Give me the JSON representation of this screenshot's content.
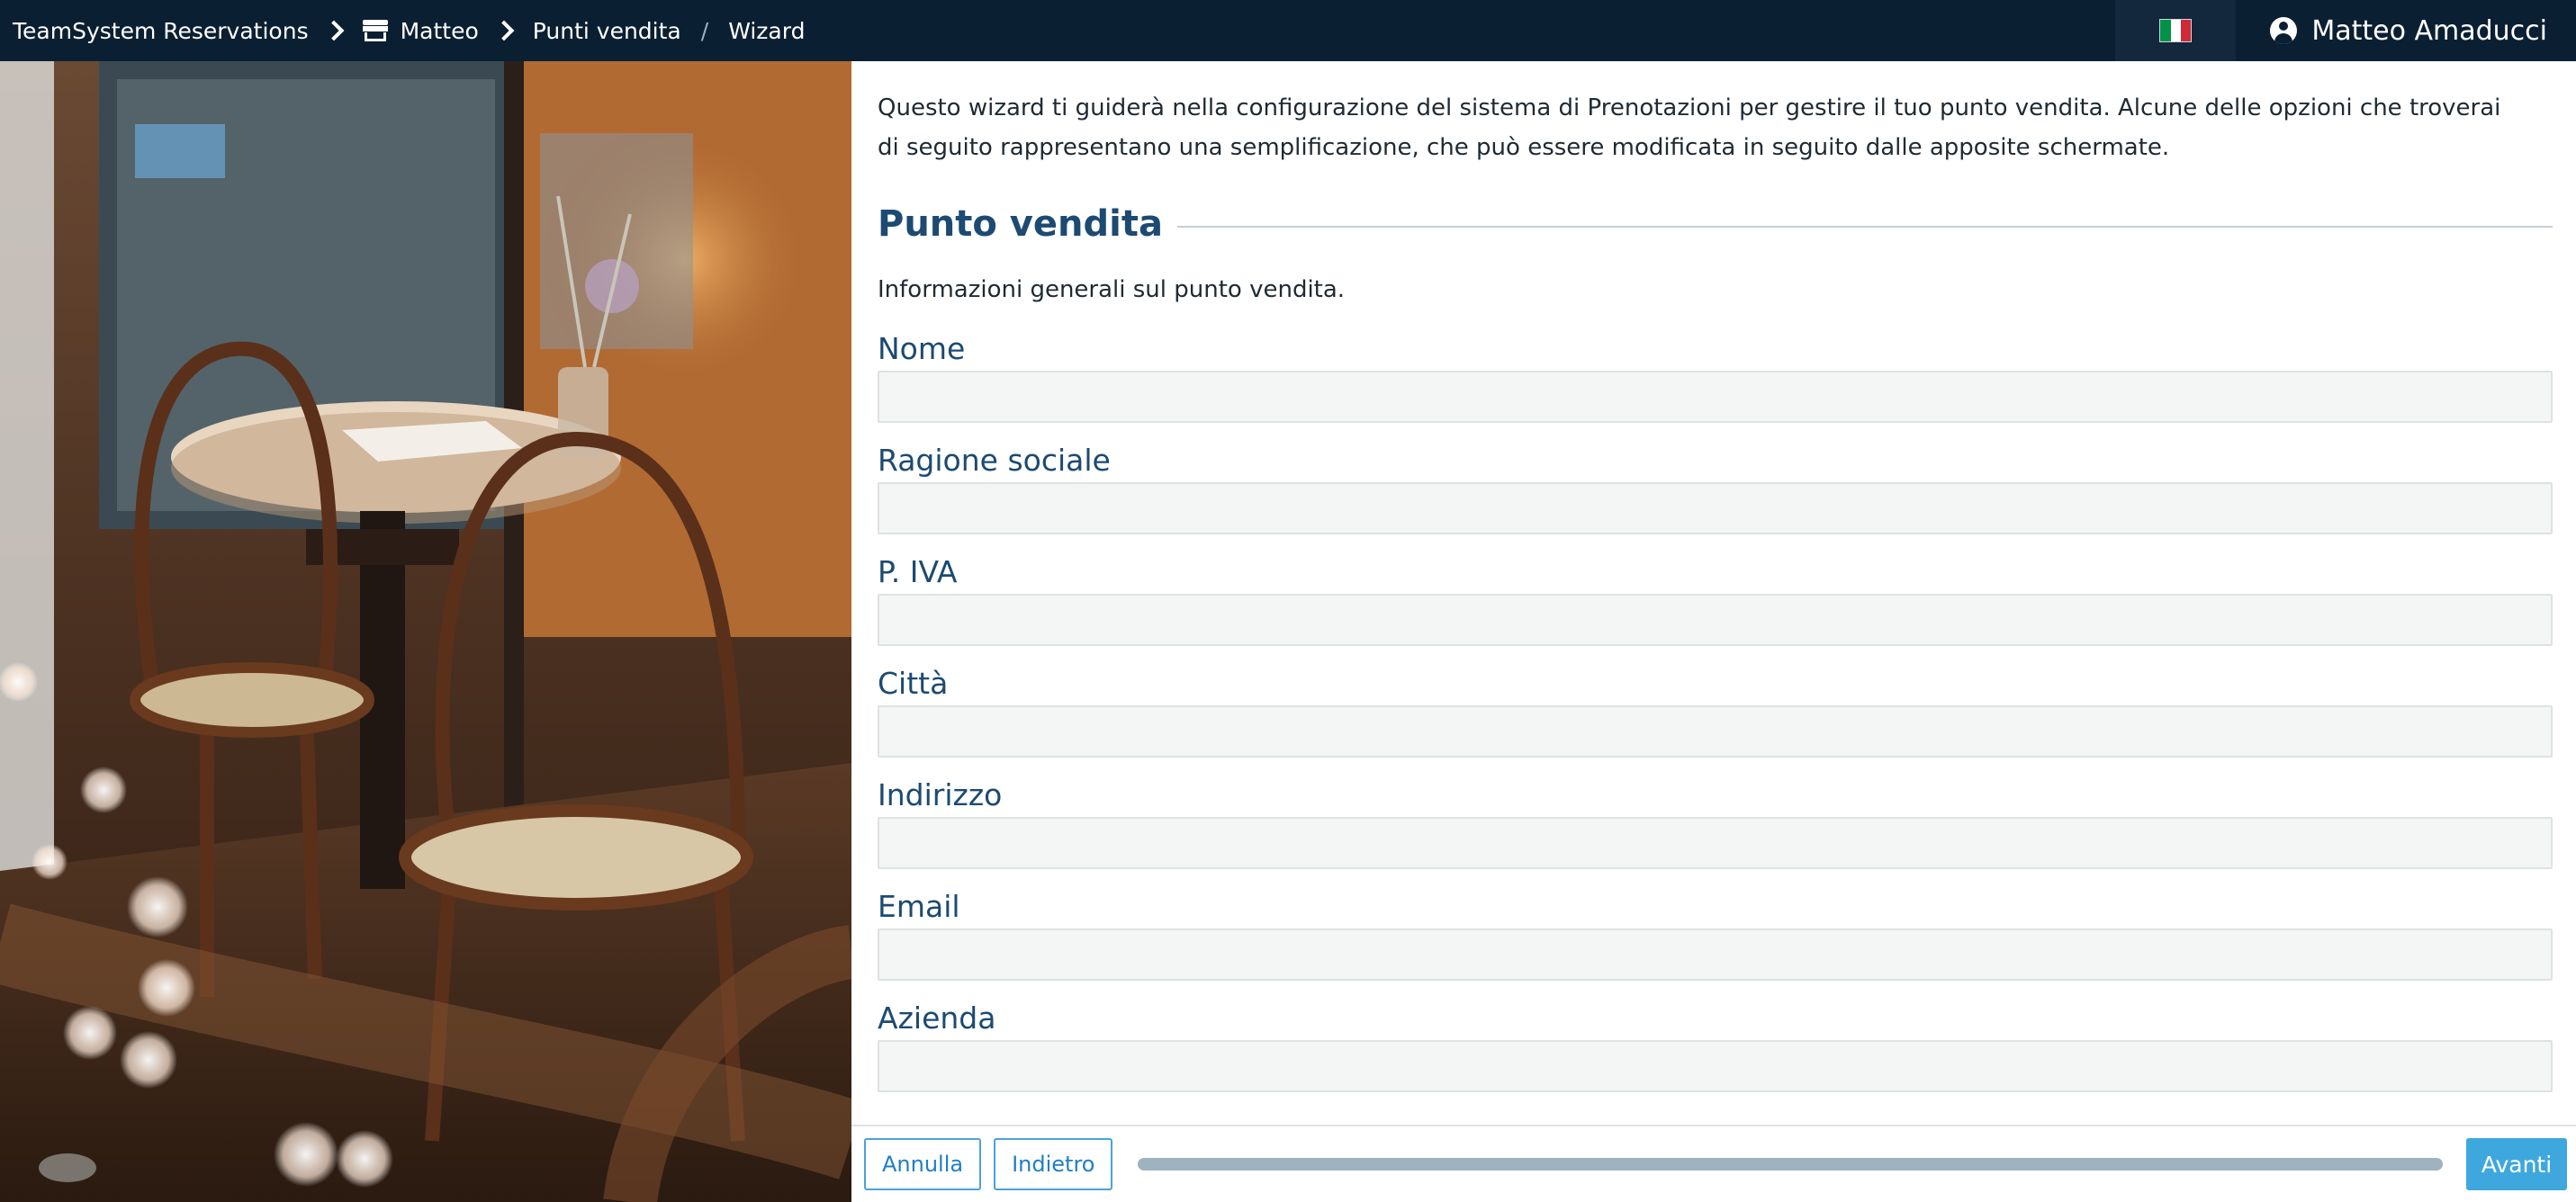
{
  "header": {
    "breadcrumb": {
      "app": "TeamSystem Reservations",
      "account": "Matteo",
      "section": "Punti vendita",
      "page": "Wizard"
    },
    "language_flag": "it-flag-icon",
    "user_name": "Matteo Amaducci"
  },
  "wizard": {
    "intro": "Questo wizard ti guiderà nella configurazione del sistema di Prenotazioni per gestire il tuo punto vendita. Alcune delle opzioni che troverai di seguito rappresentano una semplificazione, che può essere modificata in seguito dalle apposite schermate.",
    "section_title": "Punto vendita",
    "section_description": "Informazioni generali sul punto vendita.",
    "fields": [
      {
        "label": "Nome",
        "value": ""
      },
      {
        "label": "Ragione sociale",
        "value": ""
      },
      {
        "label": "P. IVA",
        "value": ""
      },
      {
        "label": "Città",
        "value": ""
      },
      {
        "label": "Indirizzo",
        "value": ""
      },
      {
        "label": "Email",
        "value": ""
      },
      {
        "label": "Azienda",
        "value": ""
      }
    ]
  },
  "footer": {
    "cancel_label": "Annulla",
    "back_label": "Indietro",
    "next_label": "Avanti",
    "progress_fraction": 1.0
  },
  "colors": {
    "topbar_bg": "#0b1f33",
    "heading": "#1c4a72",
    "accent": "#3ea8de",
    "flag_green": "#009246",
    "flag_white": "#ffffff",
    "flag_red": "#ce2b37"
  },
  "icons": {
    "breadcrumb_separator": "chevron-right-icon",
    "account": "store-icon",
    "user": "account-circle-icon"
  }
}
